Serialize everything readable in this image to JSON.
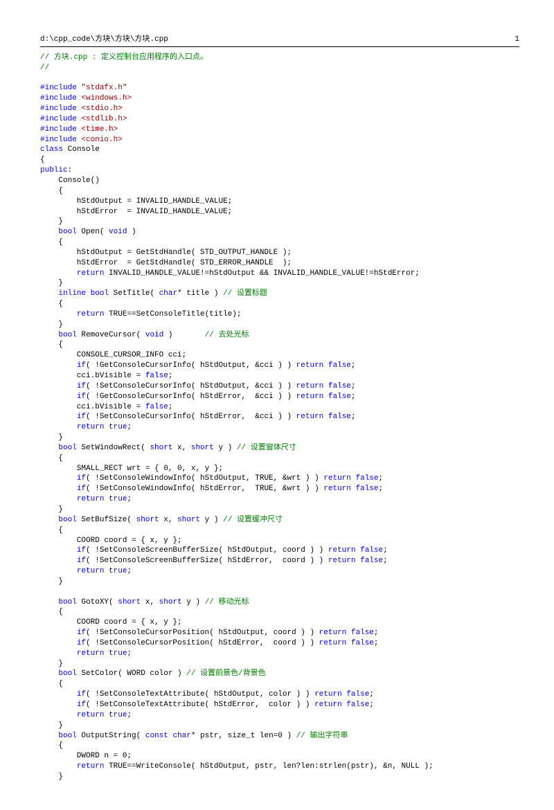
{
  "header": {
    "path": "d:\\cpp_code\\方块\\方块\\方块.cpp",
    "page_no": "1"
  },
  "code": {
    "c1": "// 方块.cpp : 定义控制台应用程序的入口点。",
    "c2": "//",
    "inc": "#include",
    "h1": "\"stdafx.h\"",
    "h2": "<windows.h>",
    "h3": "<stdio.h>",
    "h4": "<stdlib.h>",
    "h5": "<time.h>",
    "h6": "<conio.h>",
    "class": "class",
    "console": " Console",
    "public": "public",
    "ctor": "    Console()",
    "ctor_b1": "        hStdOutput = INVALID_HANDLE_VALUE;",
    "ctor_b2": "        hStdError  = INVALID_HANDLE_VALUE;",
    "bool": "bool",
    "void": "void",
    "inline": "inline",
    "char": "char",
    "short": "short",
    "const": "const",
    "return": "return",
    "true": "true",
    "false": "false",
    "if": "if",
    "open_sig": " Open( ",
    "open_b1": "        hStdOutput = GetStdHandle( STD_OUTPUT_HANDLE );",
    "open_b2": "        hStdError  = GetStdHandle( STD_ERROR_HANDLE  );",
    "open_ret": " INVALID_HANDLE_VALUE!=hStdOutput && INVALID_HANDLE_VALUE!=hStdError;",
    "settitle_sig": " SetTitle( ",
    "settitle_arg": "* title ) ",
    "settitle_c": "// 设置标题",
    "settitle_ret": " TRUE==SetConsoleTitle(title);",
    "remcur_sig": " RemoveCursor( ",
    "remcur_pad": " )       ",
    "remcur_c": "// 去处光标",
    "remcur_b1": "        CONSOLE_CURSOR_INFO cci;",
    "remcur_if1a": "( !GetConsoleCursorInfo( hStdOutput, &cci ) ) ",
    "remcur_b3a": "        cci.bVisible = ",
    "remcur_if2a": "( !SetConsoleCursorInfo( hStdOutput, &cci ) ) ",
    "remcur_if3a": "( !GetConsoleCursorInfo( hStdError,  &cci ) ) ",
    "remcur_if4a": "( !SetConsoleCursorInfo( hStdError,  &cci ) ) ",
    "swr_sig": " SetWindowRect( ",
    "swr_arg": " x, ",
    "swr_arg2": " y ) ",
    "swr_c": "// 设置窗体尺寸",
    "swr_b1": "        SMALL_RECT wrt = { 0, 0, x, y };",
    "swr_if1": "( !SetConsoleWindowInfo( hStdOutput, TRUE, &wrt ) ) ",
    "swr_if2": "( !SetConsoleWindowInfo( hStdError,  TRUE, &wrt ) ) ",
    "sbs_sig": " SetBufSize( ",
    "sbs_c": "// 设置缓冲尺寸",
    "sbs_b1": "        COORD coord = { x, y };",
    "sbs_if1": "( !SetConsoleScreenBufferSize( hStdOutput, coord ) ) ",
    "sbs_if2": "( !SetConsoleScreenBufferSize( hStdError,  coord ) ) ",
    "gxy_sig": " GotoXY( ",
    "gxy_c": "// 移动光标",
    "gxy_if1": "( !SetConsoleCursorPosition( hStdOutput, coord ) ) ",
    "gxy_if2": "( !SetConsoleCursorPosition( hStdError,  coord ) ) ",
    "sc_sig": " SetColor( WORD color ) ",
    "sc_c": "// 设置前景色/背景色",
    "sc_if1": "( !SetConsoleTextAttribute( hStdOutput, color ) ) ",
    "sc_if2": "( !SetConsoleTextAttribute( hStdError,  color ) ) ",
    "os_sig": " OutputString( ",
    "os_arg": "* pstr, size_t len=0 ) ",
    "os_c": "// 输出字符串",
    "os_b1": "        DWORD n = 0;",
    "os_ret": " TRUE==WriteConsole( hStdOutput, pstr, len?len:strlen(pstr), &n, NULL );",
    "lb": "{",
    "rb": "}",
    "lb4": "    {",
    "rb4": "    }",
    "sp4": "    ",
    "sp8": "        ",
    "semi": ";",
    "colon": ":",
    "cparen": " )"
  }
}
